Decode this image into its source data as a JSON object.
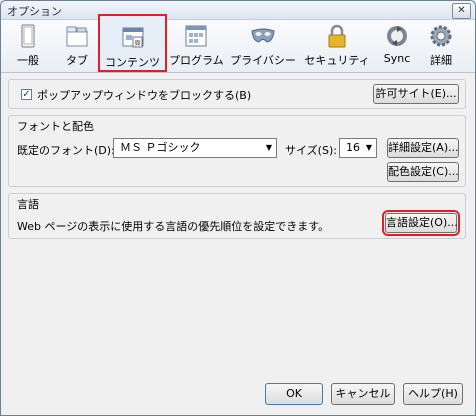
{
  "window": {
    "title": "オプション",
    "close_label": "✕"
  },
  "toolbar": {
    "tabs": [
      {
        "label": "一般",
        "icon": "general-icon"
      },
      {
        "label": "タブ",
        "icon": "tabs-icon"
      },
      {
        "label": "コンテンツ",
        "icon": "content-icon"
      },
      {
        "label": "プログラム",
        "icon": "applications-icon"
      },
      {
        "label": "プライバシー",
        "icon": "privacy-mask-icon"
      },
      {
        "label": "セキュリティ",
        "icon": "lock-icon"
      },
      {
        "label": "Sync",
        "icon": "sync-icon"
      },
      {
        "label": "詳細",
        "icon": "gear-icon"
      }
    ],
    "selected": "コンテンツ"
  },
  "popup": {
    "checkbox_label": "ポップアップウィンドウをブロックする(B)",
    "checked": true,
    "exceptions_button": "許可サイト(E)..."
  },
  "fonts": {
    "group_title": "フォントと配色",
    "default_font_label": "既定のフォント(D):",
    "default_font_value": "ＭＳ Ｐゴシック",
    "size_label": "サイズ(S):",
    "size_value": "16",
    "advanced_button": "詳細設定(A)...",
    "colors_button": "配色設定(C)..."
  },
  "languages": {
    "group_title": "言語",
    "description": "Web ページの表示に使用する言語の優先順位を設定できます。",
    "choose_button": "言語設定(O)..."
  },
  "footer": {
    "ok": "OK",
    "cancel": "キャンセル",
    "help": "ヘルプ(H)"
  }
}
